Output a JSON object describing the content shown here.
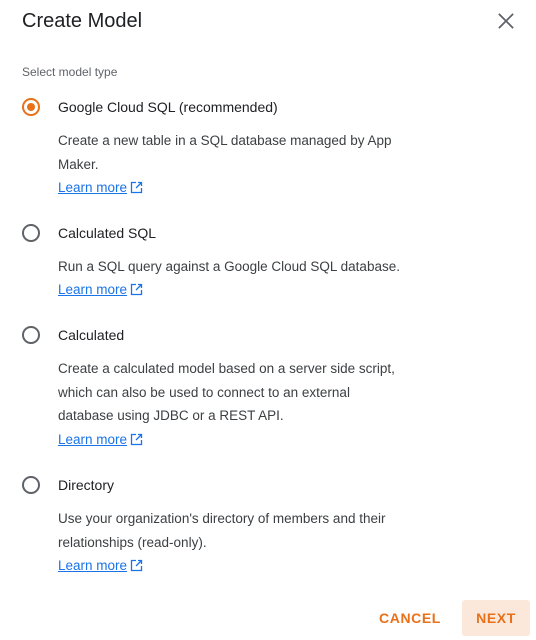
{
  "dialog": {
    "title": "Create Model",
    "close_icon": "close-icon"
  },
  "section_label": "Select model type",
  "options": [
    {
      "label": "Google Cloud SQL (recommended)",
      "description": "Create a new table in a SQL database managed by App Maker.",
      "link": "Learn more",
      "selected": true
    },
    {
      "label": "Calculated SQL",
      "description": "Run a SQL query against a Google Cloud SQL database.",
      "link": "Learn more",
      "selected": false
    },
    {
      "label": "Calculated",
      "description": "Create a calculated model based on a server side script, which can also be used to connect to an external database using JDBC or a REST API.",
      "link": "Learn more",
      "selected": false
    },
    {
      "label": "Directory",
      "description": "Use your organization's directory of members and their relationships (read-only).",
      "link": "Learn more",
      "selected": false
    }
  ],
  "buttons": {
    "cancel": "CANCEL",
    "next": "NEXT"
  },
  "colors": {
    "accent": "#e8711a",
    "link": "#1a73e8",
    "next_bg": "#fce8db"
  }
}
